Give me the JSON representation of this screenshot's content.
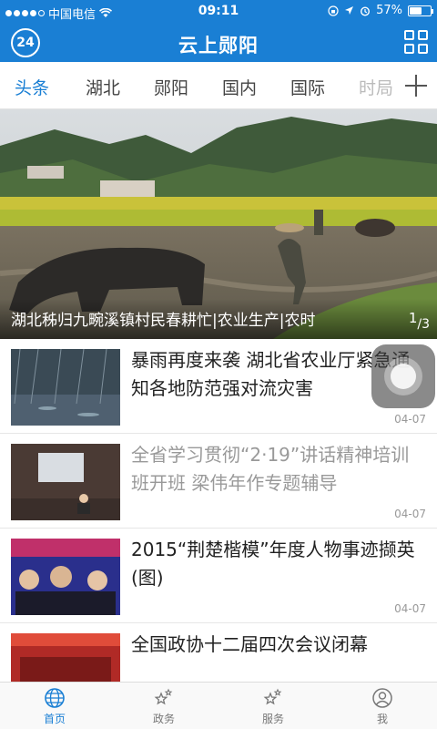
{
  "status_bar": {
    "carrier": "中国电信",
    "time": "09:11",
    "battery": "57%",
    "battery_level": 0.57
  },
  "navbar": {
    "logo": "24",
    "title": "云上郧阳"
  },
  "tabs": [
    "头条",
    "湖北",
    "郧阳",
    "国内",
    "国际",
    "时局"
  ],
  "hero": {
    "caption": "湖北秭归九畹溪镇村民春耕忙|农业生产|农时",
    "pager_current": "1",
    "pager_total": "3"
  },
  "news": [
    {
      "headline": "暴雨再度来袭 湖北省农业厅紧急通知各地防范强对流灾害",
      "date": "04-07"
    },
    {
      "headline": "全省学习贯彻“2·19”讲话精神培训班开班 梁伟年作专题辅导",
      "date": "04-07"
    },
    {
      "headline": "2015“荆楚楷模”年度人物事迹撷英(图)",
      "date": "04-07"
    },
    {
      "headline": "全国政协十二届四次会议闭幕",
      "date": ""
    }
  ],
  "bottom_tabs": [
    {
      "label": "首页",
      "icon": "globe-icon"
    },
    {
      "label": "政务",
      "icon": "stars-icon"
    },
    {
      "label": "服务",
      "icon": "stars-icon"
    },
    {
      "label": "我",
      "icon": "user-icon"
    }
  ]
}
